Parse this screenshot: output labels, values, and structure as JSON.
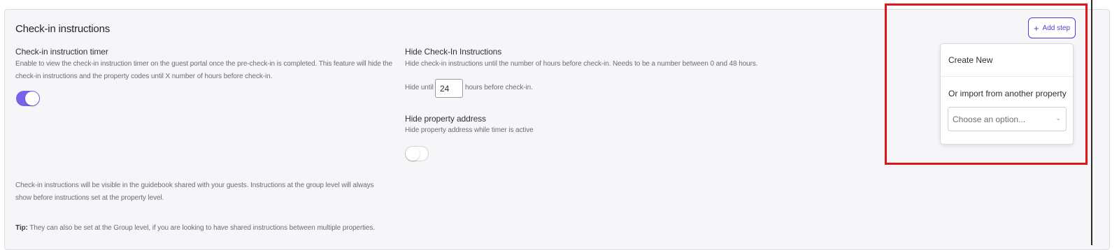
{
  "section": {
    "title": "Check-in instructions",
    "add_step_label": "Add step"
  },
  "timer": {
    "label": "Check-in instruction timer",
    "description_line1": "Enable to view the check-in instruction timer on the guest portal once the pre-check-in is completed. This feature will hide the",
    "description_line2": "check-in instructions and the property codes until X number of hours before check-in.",
    "enabled": true
  },
  "hide_instructions": {
    "label": "Hide Check-In Instructions",
    "description": "Hide check-in instructions until the number of hours before check-in. Needs to be a number between 0 and 48 hours.",
    "prefix": "Hide until",
    "hours_value": "24",
    "suffix": "hours before check-in."
  },
  "hide_address": {
    "label": "Hide property address",
    "description": "Hide property address while timer is active",
    "enabled": false
  },
  "footer": {
    "note_line1": "Check-in instructions will be visible in the guidebook shared with your guests. Instructions at the group level will always",
    "note_line2": "show before instructions set at the property level.",
    "tip_label": "Tip:",
    "tip_text": " They can also be set at the Group level, if you are looking to have shared instructions between multiple properties."
  },
  "dropdown": {
    "create_new": "Create New",
    "import_label": "Or import from another property",
    "select_placeholder": "Choose an option..."
  },
  "colors": {
    "accent": "#7b61e8",
    "button_text": "#4a3fd0",
    "highlight": "#e0161c"
  },
  "icons": [
    "plus-icon",
    "chevron-down-icon"
  ]
}
